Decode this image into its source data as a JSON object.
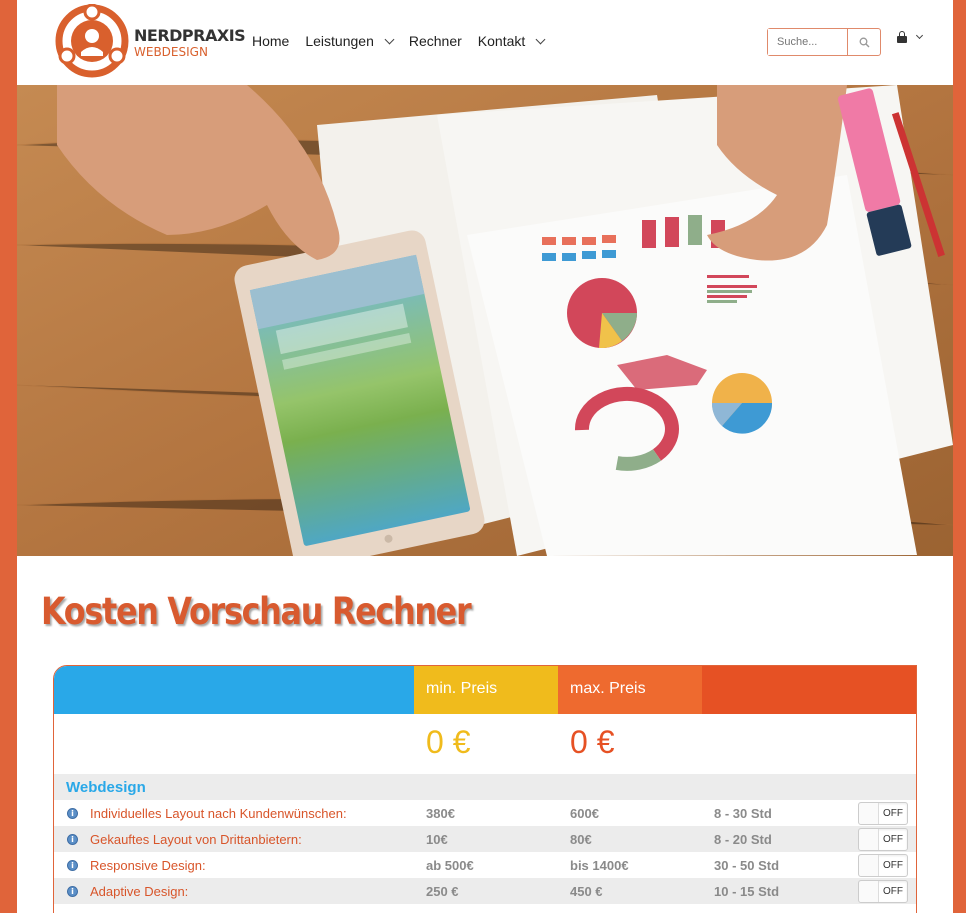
{
  "header": {
    "logo_title": "NERDPRAXIS",
    "logo_sub": "WEBDESIGN",
    "nav": [
      {
        "label": "Home",
        "dropdown": false
      },
      {
        "label": "Leistungen",
        "dropdown": true
      },
      {
        "label": "Rechner",
        "dropdown": false
      },
      {
        "label": "Kontakt",
        "dropdown": true
      }
    ],
    "search_placeholder": "Suche...",
    "icons": {
      "search": "search-icon",
      "user": "lock-icon"
    }
  },
  "calculator": {
    "title": "Kosten Vorschau Rechner",
    "headers": {
      "item": "",
      "min": "min. Preis",
      "max": "max. Preis",
      "duration": ""
    },
    "totals": {
      "min": "0 €",
      "max": "0 €"
    },
    "section": "Webdesign",
    "rows": [
      {
        "name": "Individuelles Layout nach Kundenwünschen:",
        "min": "380€",
        "max": "600€",
        "duration": "8 - 30 Std",
        "toggle": "OFF"
      },
      {
        "name": "Gekauftes Layout von Drittanbietern:",
        "min": "10€",
        "max": "80€",
        "duration": "8 - 20 Std",
        "toggle": "OFF"
      },
      {
        "name": "Responsive Design:",
        "min": "ab 500€",
        "max": "bis 1400€",
        "duration": "30 - 50 Std",
        "toggle": "OFF"
      },
      {
        "name": "Adaptive Design:",
        "min": "250 €",
        "max": "450 €",
        "duration": "10 - 15 Std",
        "toggle": "OFF"
      }
    ],
    "colors": {
      "blue": "#29a8e8",
      "yellow": "#f0bb1c",
      "orange": "#ee6a2f",
      "red": "#e65124"
    }
  }
}
